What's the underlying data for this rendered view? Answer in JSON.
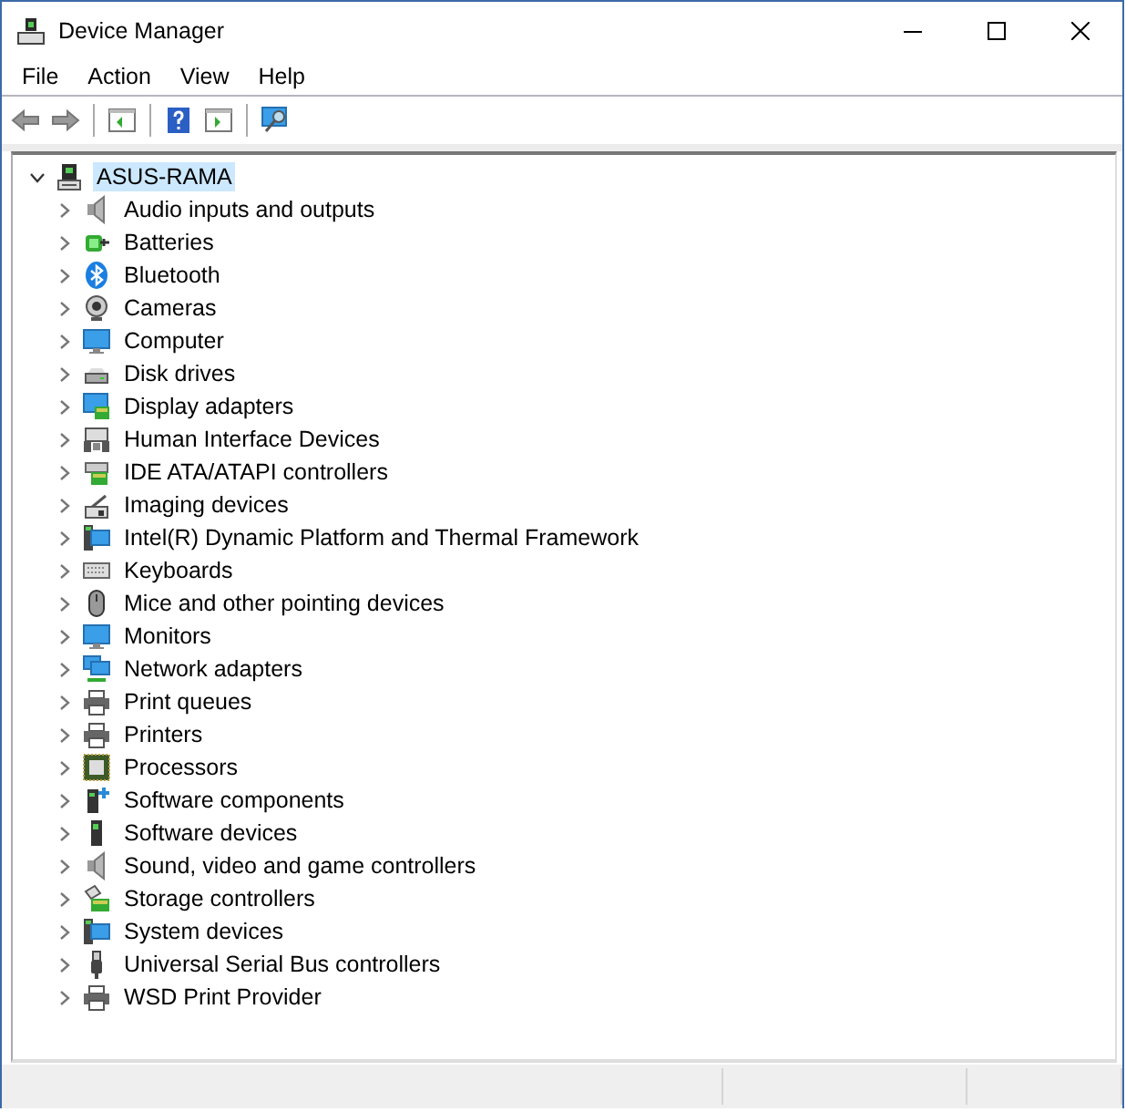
{
  "window": {
    "title": "Device Manager"
  },
  "menu": [
    "File",
    "Action",
    "View",
    "Help"
  ],
  "tree": {
    "label": "ASUS-RAMA",
    "kind": "computer",
    "selected": true,
    "expanded": true,
    "children": [
      {
        "label": "Audio inputs and outputs",
        "kind": "speaker",
        "selected": false,
        "expanded": false
      },
      {
        "label": "Batteries",
        "kind": "battery",
        "selected": false,
        "expanded": false
      },
      {
        "label": "Bluetooth",
        "kind": "bluetooth",
        "selected": false,
        "expanded": false
      },
      {
        "label": "Cameras",
        "kind": "camera",
        "selected": false,
        "expanded": false
      },
      {
        "label": "Computer",
        "kind": "monitor",
        "selected": false,
        "expanded": false
      },
      {
        "label": "Disk drives",
        "kind": "disk",
        "selected": false,
        "expanded": false
      },
      {
        "label": "Display adapters",
        "kind": "display",
        "selected": false,
        "expanded": false
      },
      {
        "label": "Human Interface Devices",
        "kind": "hid",
        "selected": false,
        "expanded": false
      },
      {
        "label": "IDE ATA/ATAPI controllers",
        "kind": "ide",
        "selected": false,
        "expanded": false
      },
      {
        "label": "Imaging devices",
        "kind": "imaging",
        "selected": false,
        "expanded": false
      },
      {
        "label": "Intel(R) Dynamic Platform and Thermal Framework",
        "kind": "system",
        "selected": false,
        "expanded": false
      },
      {
        "label": "Keyboards",
        "kind": "keyboard",
        "selected": false,
        "expanded": false
      },
      {
        "label": "Mice and other pointing devices",
        "kind": "mouse",
        "selected": false,
        "expanded": false
      },
      {
        "label": "Monitors",
        "kind": "monitor",
        "selected": false,
        "expanded": false
      },
      {
        "label": "Network adapters",
        "kind": "network",
        "selected": false,
        "expanded": false
      },
      {
        "label": "Print queues",
        "kind": "printer",
        "selected": false,
        "expanded": false
      },
      {
        "label": "Printers",
        "kind": "printer",
        "selected": false,
        "expanded": false
      },
      {
        "label": "Processors",
        "kind": "processor",
        "selected": false,
        "expanded": false
      },
      {
        "label": "Software components",
        "kind": "component",
        "selected": false,
        "expanded": false
      },
      {
        "label": "Software devices",
        "kind": "tower",
        "selected": false,
        "expanded": false
      },
      {
        "label": "Sound, video and game controllers",
        "kind": "speaker",
        "selected": false,
        "expanded": false
      },
      {
        "label": "Storage controllers",
        "kind": "storage",
        "selected": false,
        "expanded": false
      },
      {
        "label": "System devices",
        "kind": "system",
        "selected": false,
        "expanded": false
      },
      {
        "label": "Universal Serial Bus controllers",
        "kind": "usb",
        "selected": false,
        "expanded": false
      },
      {
        "label": "WSD Print Provider",
        "kind": "printer",
        "selected": false,
        "expanded": false
      }
    ]
  }
}
